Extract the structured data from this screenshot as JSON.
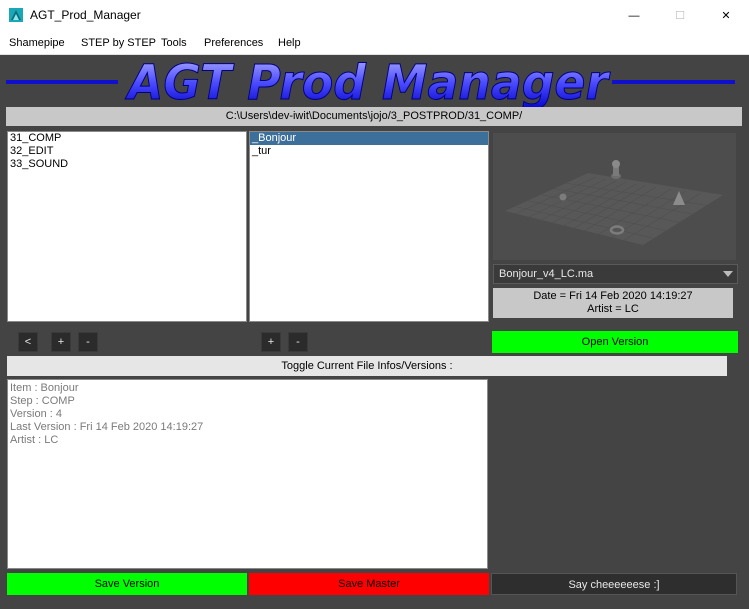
{
  "window": {
    "title": "AGT_Prod_Manager",
    "minimize_glyph": "—",
    "maximize_glyph": "☐",
    "close_glyph": "✕"
  },
  "menu": {
    "items": [
      "Shamepipe",
      "STEP by STEP",
      "Tools",
      "Preferences",
      "Help"
    ]
  },
  "banner": {
    "title": "AGT Prod Manager",
    "text_color": "#1010ff",
    "line_color": "#1010cc"
  },
  "path": "C:\\Users\\dev-iwit\\Documents\\jojo/3_POSTPROD/31_COMP/",
  "steps_list": {
    "items": [
      "31_COMP",
      "32_EDIT",
      "33_SOUND"
    ]
  },
  "items_list": {
    "items": [
      "_Bonjour",
      "_tur"
    ],
    "selected_index": 0
  },
  "buttons": {
    "prev": "<",
    "add_step": "+",
    "remove_step": "-",
    "add_item": "+",
    "remove_item": "-",
    "open_version": "Open Version",
    "save_version": "Save Version",
    "save_master": "Save Master",
    "say_cheese": "Say cheeeeeese :]"
  },
  "version_select": {
    "value": "Bonjour_v4_LC.ma"
  },
  "version_info": {
    "date": "Date = Fri 14 Feb 2020 14:19:27",
    "artist": "Artist = LC"
  },
  "toggle_label": "Toggle Current File Infos/Versions :",
  "file_details": {
    "item": "Item : Bonjour",
    "step": "Step : COMP",
    "version": "Version : 4",
    "last_version": "Last Version : Fri 14 Feb 2020 14:19:27",
    "artist": "Artist : LC"
  },
  "colors": {
    "background": "#444444",
    "green": "#00ff00",
    "red": "#ff0000",
    "selection": "#3d6f9b"
  }
}
